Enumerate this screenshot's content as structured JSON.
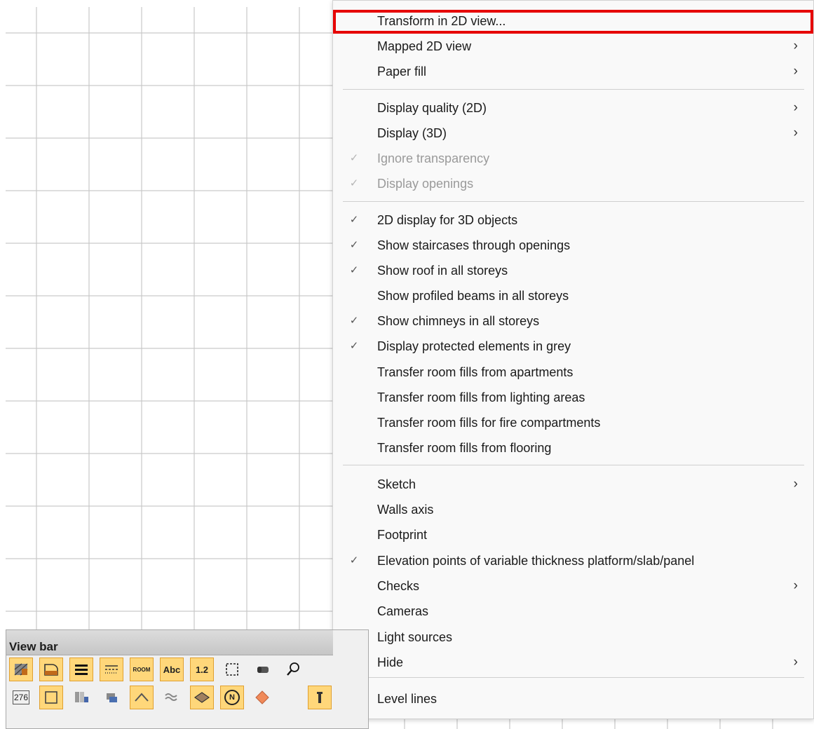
{
  "menu": {
    "items": [
      {
        "label": "Transform in 2D view...",
        "check": false,
        "submenu": false,
        "disabled": false,
        "highlighted": true
      },
      {
        "label": "Mapped 2D view",
        "check": false,
        "submenu": true,
        "disabled": false
      },
      {
        "label": "Paper fill",
        "check": false,
        "submenu": true,
        "disabled": false
      },
      {
        "label": "Display quality (2D)",
        "check": false,
        "submenu": true,
        "disabled": false
      },
      {
        "label": "Display (3D)",
        "check": false,
        "submenu": true,
        "disabled": false
      },
      {
        "label": "Ignore transparency",
        "check": true,
        "submenu": false,
        "disabled": true
      },
      {
        "label": "Display openings",
        "check": true,
        "submenu": false,
        "disabled": true
      },
      {
        "label": "2D display for 3D objects",
        "check": true,
        "submenu": false,
        "disabled": false
      },
      {
        "label": "Show staircases through openings",
        "check": true,
        "submenu": false,
        "disabled": false
      },
      {
        "label": "Show roof in all storeys",
        "check": true,
        "submenu": false,
        "disabled": false
      },
      {
        "label": "Show profiled beams in all storeys",
        "check": false,
        "submenu": false,
        "disabled": false
      },
      {
        "label": "Show chimneys in all storeys",
        "check": true,
        "submenu": false,
        "disabled": false
      },
      {
        "label": "Display protected elements in grey",
        "check": true,
        "submenu": false,
        "disabled": false
      },
      {
        "label": "Transfer room fills from apartments",
        "check": false,
        "submenu": false,
        "disabled": false
      },
      {
        "label": "Transfer room fills from lighting areas",
        "check": false,
        "submenu": false,
        "disabled": false
      },
      {
        "label": "Transfer room fills for fire compartments",
        "check": false,
        "submenu": false,
        "disabled": false
      },
      {
        "label": "Transfer room fills from flooring",
        "check": false,
        "submenu": false,
        "disabled": false
      },
      {
        "label": "Sketch",
        "check": false,
        "submenu": true,
        "disabled": false
      },
      {
        "label": "Walls axis",
        "check": false,
        "submenu": false,
        "disabled": false
      },
      {
        "label": "Footprint",
        "check": false,
        "submenu": false,
        "disabled": false
      },
      {
        "label": "Elevation points of variable thickness platform/slab/panel",
        "check": true,
        "submenu": false,
        "disabled": false
      },
      {
        "label": "Checks",
        "check": false,
        "submenu": true,
        "disabled": false
      },
      {
        "label": "Cameras",
        "check": false,
        "submenu": false,
        "disabled": false
      },
      {
        "label": "Light sources",
        "check": false,
        "submenu": false,
        "disabled": false
      },
      {
        "label": "Hide",
        "check": false,
        "submenu": true,
        "disabled": false
      },
      {
        "label": "Level lines",
        "check": false,
        "submenu": false,
        "disabled": false
      }
    ],
    "check_glyph": "✓",
    "arrow_glyph": "›"
  },
  "viewbar": {
    "title": "View bar",
    "row1": [
      {
        "icon": "hatch-fill-icon",
        "text": "",
        "active": true
      },
      {
        "icon": "pattern-fill-icon",
        "text": "",
        "active": true
      },
      {
        "icon": "line-thickness-icon",
        "text": "",
        "active": true
      },
      {
        "icon": "line-style-icon",
        "text": "",
        "active": true
      },
      {
        "icon": "room-label-icon",
        "text": "ROOM",
        "active": true
      },
      {
        "icon": "text-icon",
        "text": "Abc",
        "active": true
      },
      {
        "icon": "dimension-icon",
        "text": "1.2",
        "active": true
      },
      {
        "icon": "frame-select-icon",
        "text": "",
        "active": false
      },
      {
        "icon": "eraser-icon",
        "text": "",
        "active": false
      },
      {
        "icon": "zoom-icon",
        "text": "",
        "active": false
      }
    ],
    "row2": [
      {
        "icon": "number-display-icon",
        "text": "276",
        "active": false
      },
      {
        "icon": "frame-icon",
        "text": "",
        "active": true
      },
      {
        "icon": "layers-icon",
        "text": "",
        "active": false
      },
      {
        "icon": "layer-stack-icon",
        "text": "",
        "active": false
      },
      {
        "icon": "roof-icon",
        "text": "",
        "active": true
      },
      {
        "icon": "wave-fill-icon",
        "text": "",
        "active": false
      },
      {
        "icon": "slab-icon",
        "text": "",
        "active": true
      },
      {
        "icon": "north-icon",
        "text": "N",
        "active": true
      },
      {
        "icon": "diamond-icon",
        "text": "",
        "active": false
      },
      {
        "icon": "cursor-icon",
        "text": "",
        "active": true
      }
    ]
  },
  "colors": {
    "highlight_outline": "#e60000",
    "tool_active": "#ffd77a",
    "grid_line": "#c9c9c9"
  }
}
